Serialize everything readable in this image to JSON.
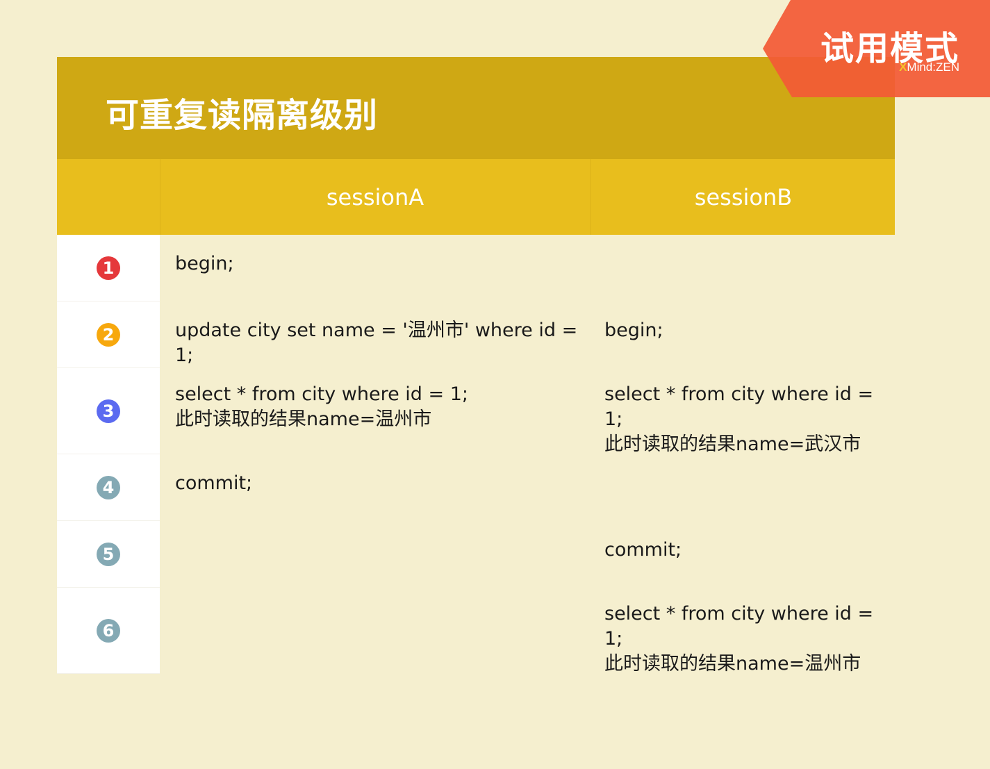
{
  "title": "可重复读隔离级别",
  "columns": [
    "",
    "sessionA",
    "sessionB"
  ],
  "rows": [
    {
      "num": "1",
      "color": "#e5383b",
      "height": 96,
      "a": "begin;",
      "b": "",
      "align": "top"
    },
    {
      "num": "2",
      "color": "#f7a80d",
      "height": 96,
      "a": "update city set name = '温州市' where id = 1;",
      "b": "begin;",
      "align": "top"
    },
    {
      "num": "3",
      "color": "#5b6af0",
      "height": 124,
      "a": "select * from city where id = 1;\n此时读取的结果name=温州市",
      "b": "select * from city where id = 1;\n此时读取的结果name=武汉市",
      "align": "top"
    },
    {
      "num": "4",
      "color": "#84a9b4",
      "height": 96,
      "a": "commit;",
      "b": "",
      "align": "top"
    },
    {
      "num": "5",
      "color": "#84a9b4",
      "height": 96,
      "a": "",
      "b": "commit;",
      "align": "top"
    },
    {
      "num": "6",
      "color": "#84a9b4",
      "height": 124,
      "a": "",
      "b": "select * from city where id = 1;\n此时读取的结果name=温州市",
      "align": "top"
    }
  ],
  "watermark": {
    "text": "试用模式",
    "logo_x": "X",
    "logo_rest": "Mind",
    "logo_sep": ":",
    "logo_zen": "ZEN",
    "color": "#f25a36"
  }
}
